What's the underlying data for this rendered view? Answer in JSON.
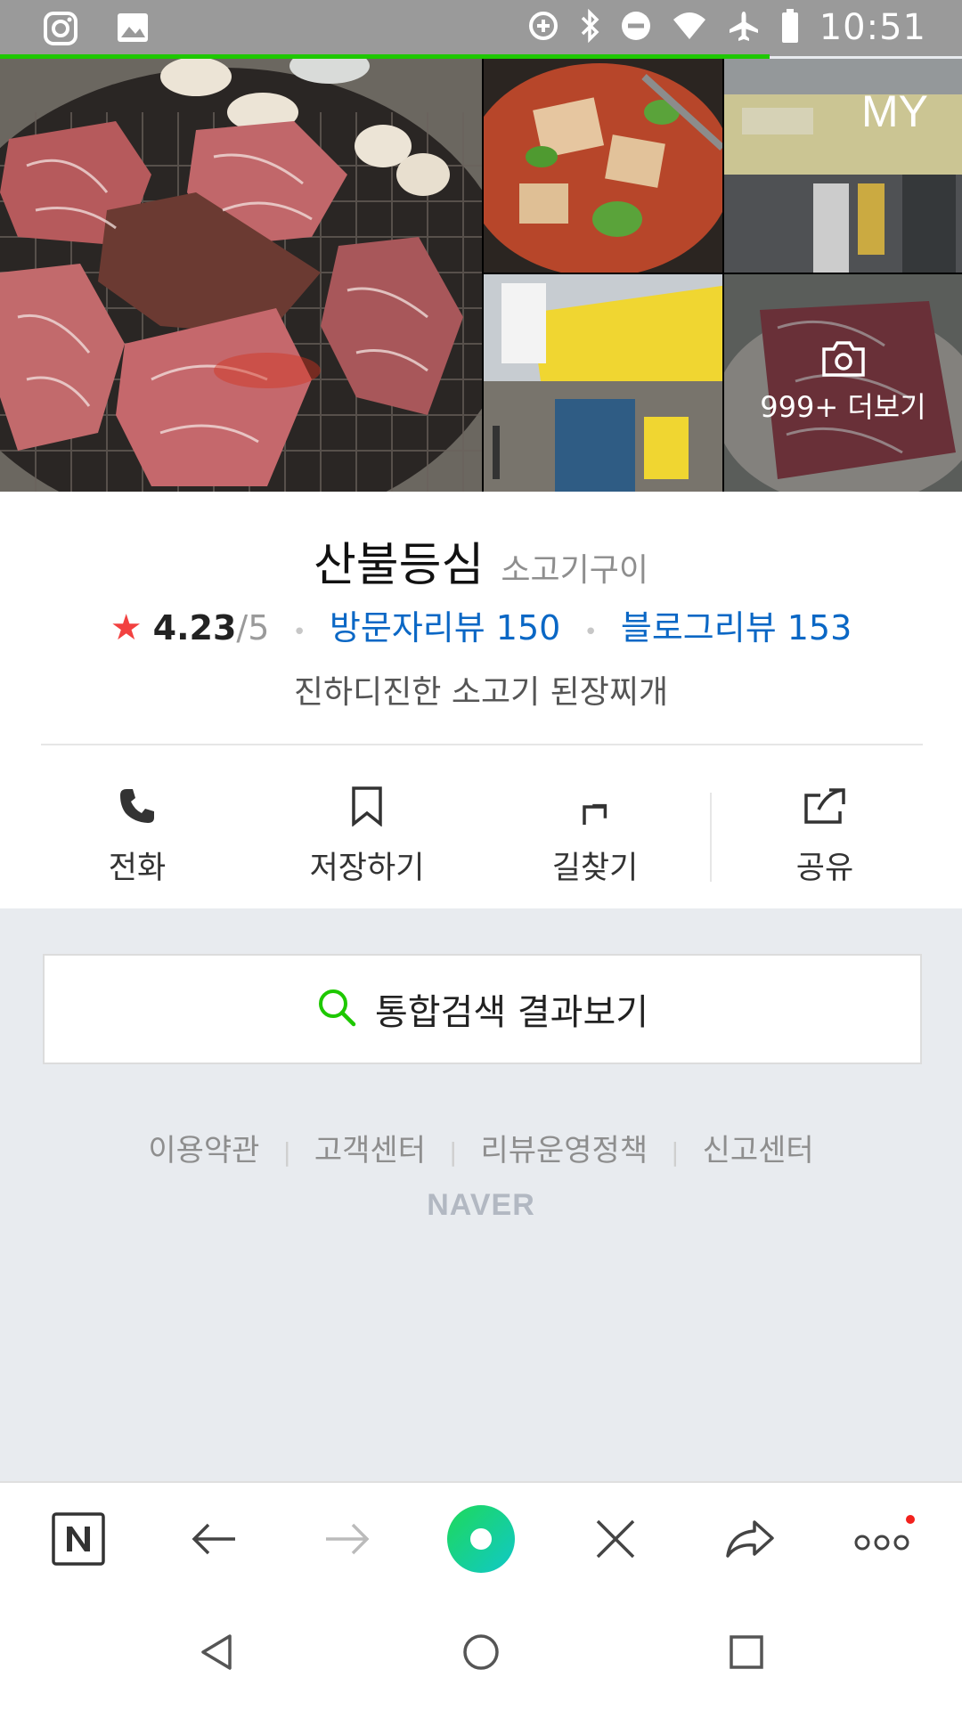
{
  "status_bar": {
    "time": "10:51",
    "left_icons": [
      "instagram-icon",
      "image-icon"
    ],
    "right_icons": [
      "data-saver-icon",
      "bluetooth-icon",
      "do-not-disturb-icon",
      "wifi-icon",
      "airplane-mode-icon",
      "battery-icon"
    ]
  },
  "page_load_progress": 0.8,
  "gallery": {
    "my_label": "MY",
    "more_label": "999+ 더보기"
  },
  "place": {
    "name": "산불등심",
    "category": "소고기구이",
    "rating": "4.23",
    "rating_max": "/5",
    "visitor_reviews": "방문자리뷰 150",
    "blog_reviews": "블로그리뷰 153",
    "description": "진하디진한 소고기 된장찌개"
  },
  "actions": [
    {
      "label": "전화",
      "icon": "phone-icon"
    },
    {
      "label": "저장하기",
      "icon": "bookmark-icon"
    },
    {
      "label": "길찾기",
      "icon": "directions-icon"
    },
    {
      "label": "공유",
      "icon": "share-icon"
    }
  ],
  "search": {
    "label": "통합검색 결과보기"
  },
  "footer": {
    "links": [
      "이용약관",
      "고객센터",
      "리뷰운영정책",
      "신고센터"
    ],
    "logo": "NAVER"
  },
  "browser_toolbar": [
    "naver-home-icon",
    "back-arrow-icon",
    "forward-arrow-icon",
    "green-dot-icon",
    "close-icon",
    "share-arrow-icon",
    "more-icon"
  ],
  "colors": {
    "accent_green": "#1ec800",
    "link_blue": "#0a67c5",
    "star_red": "#f24140"
  }
}
